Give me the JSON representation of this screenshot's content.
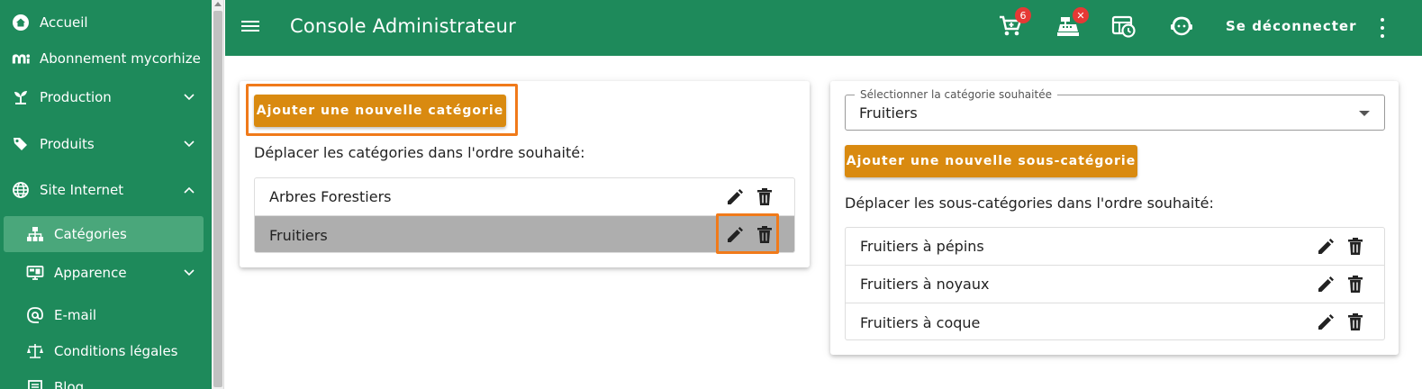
{
  "sidebar": {
    "items": [
      {
        "label": "Accueil",
        "icon": "home-icon"
      },
      {
        "label": "Abonnement mycorhize",
        "icon": "mycorhize-logo-icon"
      },
      {
        "label": "Production",
        "icon": "sprout-icon"
      },
      {
        "label": "Produits",
        "icon": "tags-icon"
      },
      {
        "label": "Site Internet",
        "icon": "globe-icon"
      },
      {
        "label": "Catégories",
        "icon": "sitemap-icon"
      },
      {
        "label": "Apparence",
        "icon": "monitor-icon"
      },
      {
        "label": "E-mail",
        "icon": "at-icon"
      },
      {
        "label": "Conditions légales",
        "icon": "scale-icon"
      },
      {
        "label": "Blog",
        "icon": "blog-icon"
      }
    ]
  },
  "header": {
    "title": "Console Administrateur",
    "cart_badge": "6",
    "register_badge": "✕",
    "logout_label": "Se déconnecter"
  },
  "categories": {
    "add_button": "Ajouter une nouvelle catégorie",
    "instruction": "Déplacer les catégories dans l'ordre souhaité:",
    "items": [
      {
        "name": "Arbres Forestiers"
      },
      {
        "name": "Fruitiers"
      }
    ]
  },
  "subcategories": {
    "select_label": "Sélectionner la catégorie souhaitée",
    "select_value": "Fruitiers",
    "add_button": "Ajouter une nouvelle sous-catégorie",
    "instruction": "Déplacer les sous-catégories dans l'ordre souhaité:",
    "items": [
      {
        "name": "Fruitiers à pépins"
      },
      {
        "name": "Fruitiers à noyaux"
      },
      {
        "name": "Fruitiers à coque"
      }
    ]
  },
  "colors": {
    "brand_green": "#1e8a5b",
    "active_nav": "#4aa77b",
    "accent_orange": "#d98a10",
    "highlight_orange": "#f07a1a",
    "badge_red": "#e53935"
  }
}
